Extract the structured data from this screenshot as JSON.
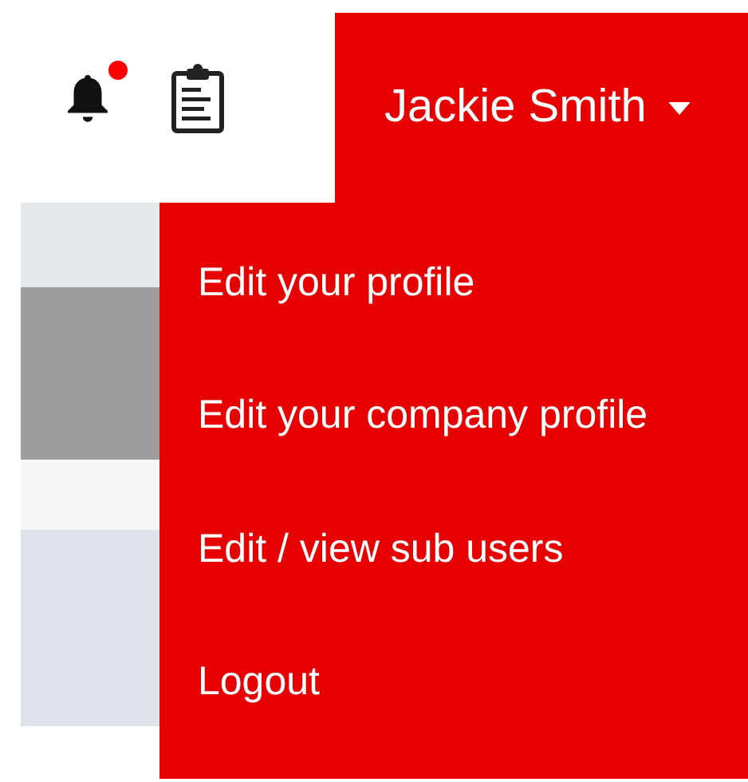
{
  "header": {
    "notifications": {
      "unread": true
    },
    "user_menu": {
      "name": "Jackie Smith",
      "expanded": true
    }
  },
  "dropdown": {
    "items": [
      {
        "label": "Edit your profile"
      },
      {
        "label": "Edit your company profile"
      },
      {
        "label": "Edit / view sub users"
      },
      {
        "label": "Logout"
      }
    ]
  }
}
